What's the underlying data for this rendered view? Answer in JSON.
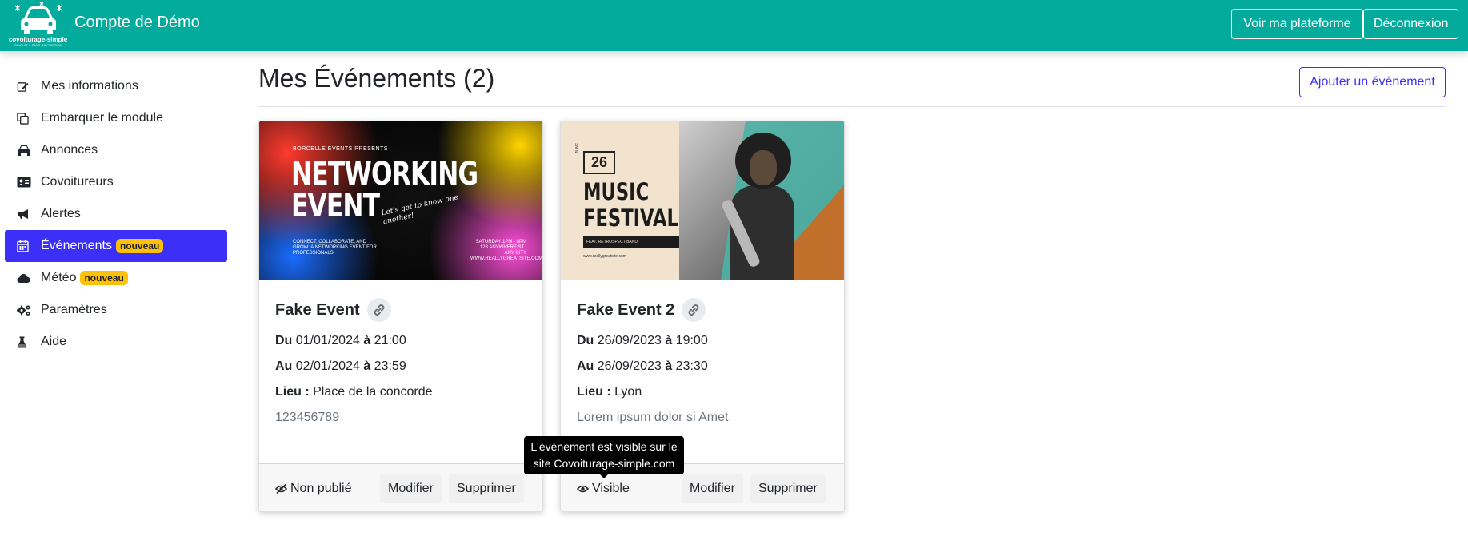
{
  "header": {
    "logo_text": "covoiturage-simple",
    "logo_subtext": "GRATUIT & SANS INSCRIPTION",
    "title": "Compte de Démo",
    "platform_button": "Voir ma plateforme",
    "logout_button": "Déconnexion"
  },
  "sidebar": {
    "items": [
      {
        "label": "Mes informations",
        "icon": "edit-icon"
      },
      {
        "label": "Embarquer le module",
        "icon": "copy-icon"
      },
      {
        "label": "Annonces",
        "icon": "car-icon"
      },
      {
        "label": "Covoitureurs",
        "icon": "id-card-icon"
      },
      {
        "label": "Alertes",
        "icon": "megaphone-icon"
      },
      {
        "label": "Événements",
        "icon": "calendar-icon",
        "badge": "nouveau",
        "active": true
      },
      {
        "label": "Météo",
        "icon": "cloud-icon",
        "badge": "nouveau"
      },
      {
        "label": "Paramètres",
        "icon": "gears-icon"
      },
      {
        "label": "Aide",
        "icon": "flask-icon"
      }
    ]
  },
  "main": {
    "title": "Mes Événements (2)",
    "add_button": "Ajouter un événement"
  },
  "events": [
    {
      "title": "Fake Event",
      "from_label": "Du",
      "from_date": "01/01/2024",
      "at_label": "à",
      "from_time": "21:00",
      "to_label": "Au",
      "to_date": "02/01/2024",
      "to_time": "23:59",
      "place_label": "Lieu :",
      "place": "Place de la concorde",
      "description": "123456789",
      "status": "Non publié",
      "status_icon": "eye-slash-icon",
      "edit_button": "Modifier",
      "delete_button": "Supprimer",
      "poster": {
        "presents": "BORCELLE EVENTS PRESENTS",
        "line1": "NETWORKING",
        "line2": "EVENT",
        "script": "Let's get to know one another!",
        "footer_left": "CONNECT, COLLABORATE, AND GROW: A NETWORKING EVENT FOR PROFESSIONALS",
        "footer_right": "SATURDAY 1PM - 8PM 123 ANYWHERE ST., ANY CITY WWW.REALLYGREATSITE.COM"
      }
    },
    {
      "title": "Fake Event 2",
      "from_label": "Du",
      "from_date": "26/09/2023",
      "at_label": "à",
      "from_time": "19:00",
      "to_label": "Au",
      "to_date": "26/09/2023",
      "to_time": "23:30",
      "place_label": "Lieu :",
      "place": "Lyon",
      "description": "Lorem ipsum dolor si Amet",
      "status": "Visible",
      "status_icon": "eye-icon",
      "edit_button": "Modifier",
      "delete_button": "Supprimer",
      "poster": {
        "month": "JUNE",
        "day": "26",
        "line1": "MUSIC",
        "line2": "FESTIVAL",
        "feat": "FEAT. RETROSPECT BAND",
        "url": "www.reallygreatsite.com"
      }
    }
  ],
  "tooltip": {
    "line1": "L'événement est visible sur le",
    "line2": "site Covoiturage-simple.com"
  },
  "colors": {
    "header_bg": "#02ab9c",
    "accent": "#3c30f8",
    "badge": "#ffc107"
  }
}
